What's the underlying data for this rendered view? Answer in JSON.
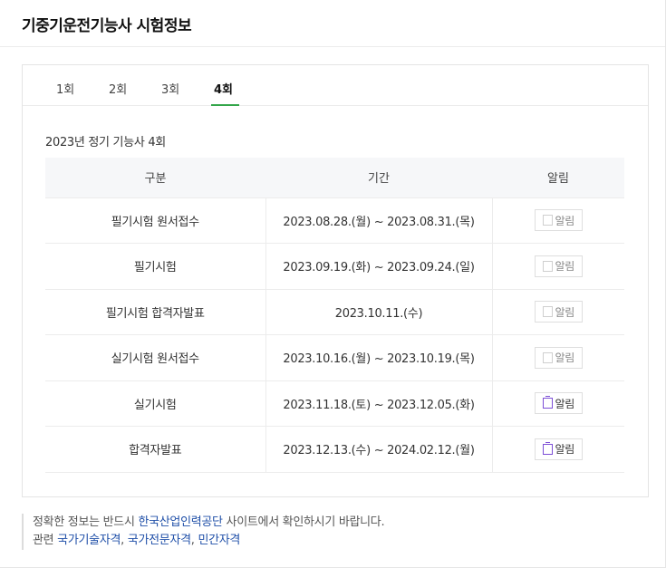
{
  "header": {
    "title": "기중기운전기능사 시험정보"
  },
  "tabs": [
    {
      "label": "1회",
      "active": false
    },
    {
      "label": "2회",
      "active": false
    },
    {
      "label": "3회",
      "active": false
    },
    {
      "label": "4회",
      "active": true
    }
  ],
  "colors": {
    "accent": "#33a64a",
    "link": "#1f4fa8",
    "alarm_on": "#7d4fd6"
  },
  "schedule": {
    "subtitle": "2023년 정기 기능사 4회",
    "headers": {
      "category": "구분",
      "period": "기간",
      "alarm": "알림"
    },
    "rows": [
      {
        "category": "필기시험 원서접수",
        "period": "2023.08.28.(월) ~ 2023.08.31.(목)",
        "alarm_label": "알림",
        "alarm_enabled": false
      },
      {
        "category": "필기시험",
        "period": "2023.09.19.(화) ~ 2023.09.24.(일)",
        "alarm_label": "알림",
        "alarm_enabled": false
      },
      {
        "category": "필기시험 합격자발표",
        "period": "2023.10.11.(수)",
        "alarm_label": "알림",
        "alarm_enabled": false
      },
      {
        "category": "실기시험 원서접수",
        "period": "2023.10.16.(월) ~ 2023.10.19.(목)",
        "alarm_label": "알림",
        "alarm_enabled": false
      },
      {
        "category": "실기시험",
        "period": "2023.11.18.(토) ~ 2023.12.05.(화)",
        "alarm_label": "알림",
        "alarm_enabled": true
      },
      {
        "category": "합격자발표",
        "period": "2023.12.13.(수) ~ 2024.02.12.(월)",
        "alarm_label": "알림",
        "alarm_enabled": true
      }
    ]
  },
  "notice": {
    "line1_prefix": "정확한 정보는 반드시 ",
    "line1_link": "한국산업인력공단",
    "line1_suffix": " 사이트에서 확인하시기 바랍니다.",
    "line2_prefix": "관련 ",
    "line2_link1": "국가기술자격",
    "line2_link2": "국가전문자격",
    "line2_link3": "민간자격",
    "separator": ", "
  }
}
